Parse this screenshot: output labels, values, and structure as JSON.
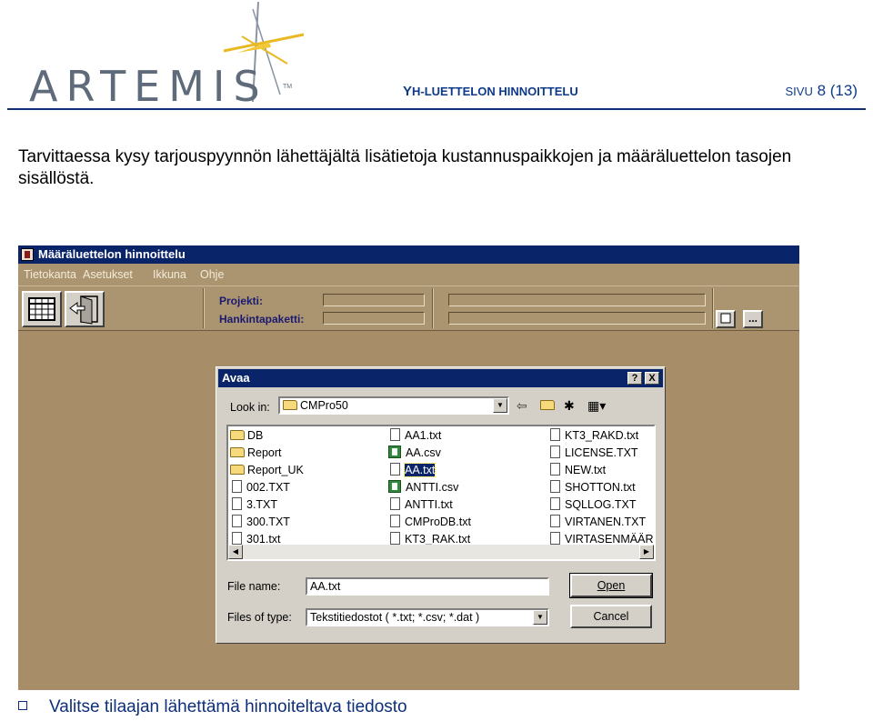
{
  "header": {
    "logo_text": "ARTEMIS",
    "logo_tm": "TM",
    "title_first": "Y",
    "title_rest": "H-LUETTELON HINNOITTELU",
    "page_label": "SIVU",
    "page_value": "8 (13)"
  },
  "intro": "Tarvittaessa kysy tarjouspyynnön lähettäjältä lisätietoja kustannuspaikkojen ja määräluettelon tasojen sisällöstä.",
  "app": {
    "title": "Määräluettelon hinnoittelu",
    "menu": [
      "Tietokanta",
      "Asetukset",
      "Ikkuna",
      "Ohje"
    ],
    "project_label": "Projekti:",
    "package_label": "Hankintapaketti:",
    "ellipsis_button": "..."
  },
  "dialog": {
    "title": "Avaa",
    "help_button": "?",
    "close_button": "X",
    "look_in_label": "Look in:",
    "look_in_value": "CMPro50",
    "files": [
      {
        "name": "DB",
        "kind": "folder"
      },
      {
        "name": "Report",
        "kind": "folder"
      },
      {
        "name": "Report_UK",
        "kind": "folder"
      },
      {
        "name": "002.TXT",
        "kind": "txt"
      },
      {
        "name": "3.TXT",
        "kind": "txt"
      },
      {
        "name": "300.TXT",
        "kind": "txt"
      },
      {
        "name": "301.txt",
        "kind": "txt"
      },
      {
        "name": "AA1.txt",
        "kind": "txt"
      },
      {
        "name": "AA.csv",
        "kind": "csv"
      },
      {
        "name": "AA.txt",
        "kind": "txt",
        "selected": true
      },
      {
        "name": "ANTTI.csv",
        "kind": "csv"
      },
      {
        "name": "ANTTI.txt",
        "kind": "txt"
      },
      {
        "name": "CMProDB.txt",
        "kind": "txt"
      },
      {
        "name": "KT3_RAK.txt",
        "kind": "txt"
      },
      {
        "name": "KT3_RAKD.txt",
        "kind": "txt"
      },
      {
        "name": "LICENSE.TXT",
        "kind": "txt"
      },
      {
        "name": "NEW.txt",
        "kind": "txt"
      },
      {
        "name": "SHOTTON.txt",
        "kind": "txt"
      },
      {
        "name": "SQLLOG.TXT",
        "kind": "txt"
      },
      {
        "name": "VIRTANEN.TXT",
        "kind": "txt"
      },
      {
        "name": "VIRTASENMÄÄR",
        "kind": "txt"
      }
    ],
    "file_name_label": "File name:",
    "file_name_value": "AA.txt",
    "files_of_type_label": "Files of type:",
    "files_of_type_value": "Tekstitiedostot ( *.txt; *.csv; *.dat )",
    "open_button": "Open",
    "cancel_button": "Cancel"
  },
  "bullet": "Valitse tilaajan lähettämä hinnoiteltava tiedosto",
  "colors": {
    "brand_blue": "#0e2f7a",
    "app_background": "#a78e68",
    "titlebar": "#0a246a",
    "dialog_face": "#d4d0c8"
  }
}
